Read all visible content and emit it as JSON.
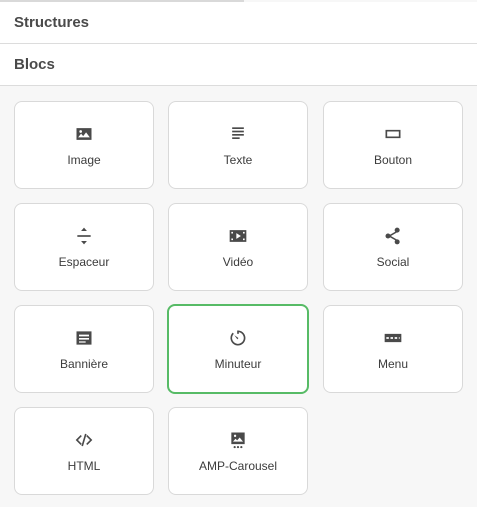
{
  "sections": {
    "structures_label": "Structures",
    "blocs_label": "Blocs"
  },
  "blocks": [
    {
      "label": "Image",
      "icon": "image-icon"
    },
    {
      "label": "Texte",
      "icon": "text-icon"
    },
    {
      "label": "Bouton",
      "icon": "button-icon"
    },
    {
      "label": "Espaceur",
      "icon": "spacer-icon"
    },
    {
      "label": "Vidéo",
      "icon": "video-icon"
    },
    {
      "label": "Social",
      "icon": "share-icon"
    },
    {
      "label": "Bannière",
      "icon": "banner-icon"
    },
    {
      "label": "Minuteur",
      "icon": "timer-icon"
    },
    {
      "label": "Menu",
      "icon": "menu-icon"
    },
    {
      "label": "HTML",
      "icon": "code-icon"
    },
    {
      "label": "AMP-Carousel",
      "icon": "carousel-icon"
    }
  ],
  "selected_block": "Minuteur",
  "colors": {
    "selected_border": "#57bb66",
    "icon": "#4a4a4a",
    "background": "#f7f7f7"
  }
}
